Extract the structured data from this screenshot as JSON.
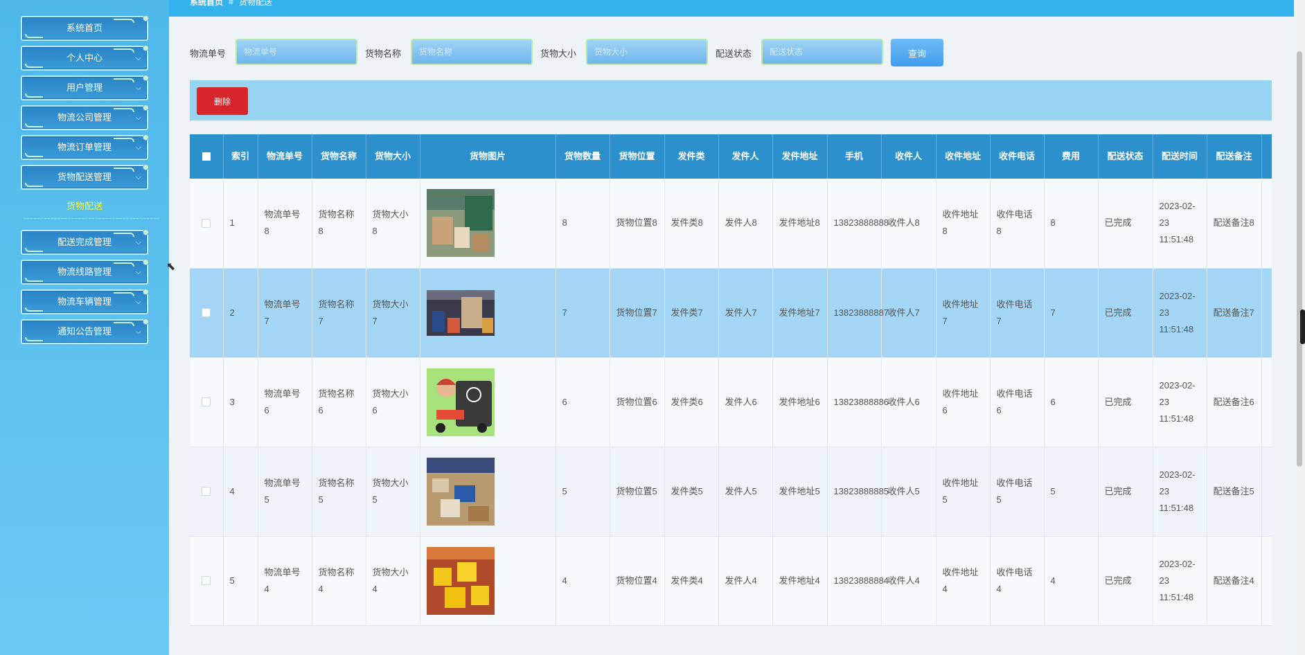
{
  "breadcrumb": {
    "home": "系统首页",
    "sep": "≡",
    "current": "货物配送"
  },
  "sidebar": {
    "items": [
      {
        "label": "系统首页"
      },
      {
        "label": "个人中心"
      },
      {
        "label": "用户管理"
      },
      {
        "label": "物流公司管理"
      },
      {
        "label": "物流订单管理"
      },
      {
        "label": "货物配送管理"
      },
      {
        "label": "配送完成管理"
      },
      {
        "label": "物流线路管理"
      },
      {
        "label": "物流车辆管理"
      },
      {
        "label": "通知公告管理"
      }
    ],
    "active_sub": "货物配送"
  },
  "search": {
    "f1_label": "物流单号",
    "f1_ph": "物流单号",
    "f2_label": "货物名称",
    "f2_ph": "货物名称",
    "f3_label": "货物大小",
    "f3_ph": "货物大小",
    "f4_label": "配送状态",
    "f4_ph": "配送状态",
    "query": "查询"
  },
  "actions": {
    "delete": "删除"
  },
  "table": {
    "headers": [
      "索引",
      "物流单号",
      "货物名称",
      "货物大小",
      "货物图片",
      "货物数量",
      "货物位置",
      "发件类",
      "发件人",
      "发件地址",
      "手机",
      "收件人",
      "收件地址",
      "收件电话",
      "费用",
      "配送状态",
      "配送时间",
      "配送备注"
    ],
    "rows": [
      {
        "idx": "1",
        "no": "物流单号8",
        "name": "货物名称8",
        "size": "货物大小8",
        "qty": "8",
        "pos": "货物位置8",
        "stype": "发件类8",
        "sender": "发件人8",
        "saddr": "发件地址8",
        "phone": "13823888888",
        "recv": "收件人8",
        "raddr": "收件地址8",
        "rphone": "收件电话8",
        "fee": "8",
        "status": "已完成",
        "time": "2023-02-23 11:51:48",
        "note": "配送备注8"
      },
      {
        "idx": "2",
        "no": "物流单号7",
        "name": "货物名称7",
        "size": "货物大小7",
        "qty": "7",
        "pos": "货物位置7",
        "stype": "发件类7",
        "sender": "发件人7",
        "saddr": "发件地址7",
        "phone": "13823888887",
        "recv": "收件人7",
        "raddr": "收件地址7",
        "rphone": "收件电话7",
        "fee": "7",
        "status": "已完成",
        "time": "2023-02-23 11:51:48",
        "note": "配送备注7"
      },
      {
        "idx": "3",
        "no": "物流单号6",
        "name": "货物名称6",
        "size": "货物大小6",
        "qty": "6",
        "pos": "货物位置6",
        "stype": "发件类6",
        "sender": "发件人6",
        "saddr": "发件地址6",
        "phone": "13823888886",
        "recv": "收件人6",
        "raddr": "收件地址6",
        "rphone": "收件电话6",
        "fee": "6",
        "status": "已完成",
        "time": "2023-02-23 11:51:48",
        "note": "配送备注6"
      },
      {
        "idx": "4",
        "no": "物流单号5",
        "name": "货物名称5",
        "size": "货物大小5",
        "qty": "5",
        "pos": "货物位置5",
        "stype": "发件类5",
        "sender": "发件人5",
        "saddr": "发件地址5",
        "phone": "13823888885",
        "recv": "收件人5",
        "raddr": "收件地址5",
        "rphone": "收件电话5",
        "fee": "5",
        "status": "已完成",
        "time": "2023-02-23 11:51:48",
        "note": "配送备注5"
      },
      {
        "idx": "5",
        "no": "物流单号4",
        "name": "货物名称4",
        "size": "货物大小4",
        "qty": "4",
        "pos": "货物位置4",
        "stype": "发件类4",
        "sender": "发件人4",
        "saddr": "发件地址4",
        "phone": "13823888884",
        "recv": "收件人4",
        "raddr": "收件地址4",
        "rphone": "收件电话4",
        "fee": "4",
        "status": "已完成",
        "time": "2023-02-23 11:51:48",
        "note": "配送备注4"
      }
    ]
  },
  "colors": {
    "sidebar": "#4db8ea",
    "header": "#2b90cc",
    "selected_row": "#a3d6f4",
    "delete": "#d6262b",
    "accent_sub": "#f6f94a"
  }
}
